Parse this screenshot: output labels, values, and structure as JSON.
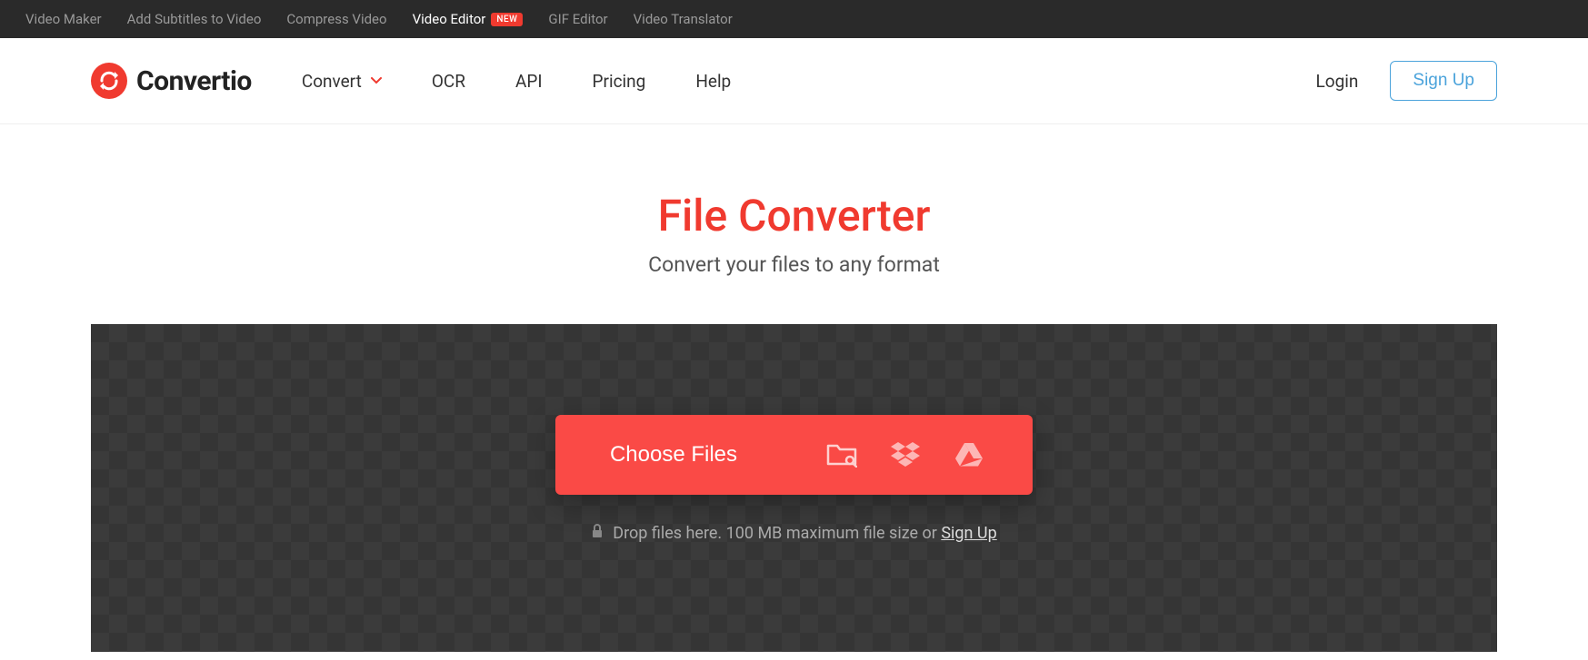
{
  "topbar": {
    "items": [
      {
        "label": "Video Maker",
        "active": false
      },
      {
        "label": "Add Subtitles to Video",
        "active": false
      },
      {
        "label": "Compress Video",
        "active": false
      },
      {
        "label": "Video Editor",
        "active": true,
        "badge": "NEW"
      },
      {
        "label": "GIF Editor",
        "active": false
      },
      {
        "label": "Video Translator",
        "active": false
      }
    ]
  },
  "header": {
    "logo_text": "Convertio",
    "nav": [
      {
        "label": "Convert",
        "dropdown": true
      },
      {
        "label": "OCR"
      },
      {
        "label": "API"
      },
      {
        "label": "Pricing"
      },
      {
        "label": "Help"
      }
    ],
    "login": "Login",
    "signup": "Sign Up"
  },
  "hero": {
    "title": "File Converter",
    "subtitle": "Convert your files to any format"
  },
  "dropzone": {
    "choose_label": "Choose Files",
    "drop_text": "Drop files here. 100 MB maximum file size or ",
    "signup_link": "Sign Up"
  }
}
